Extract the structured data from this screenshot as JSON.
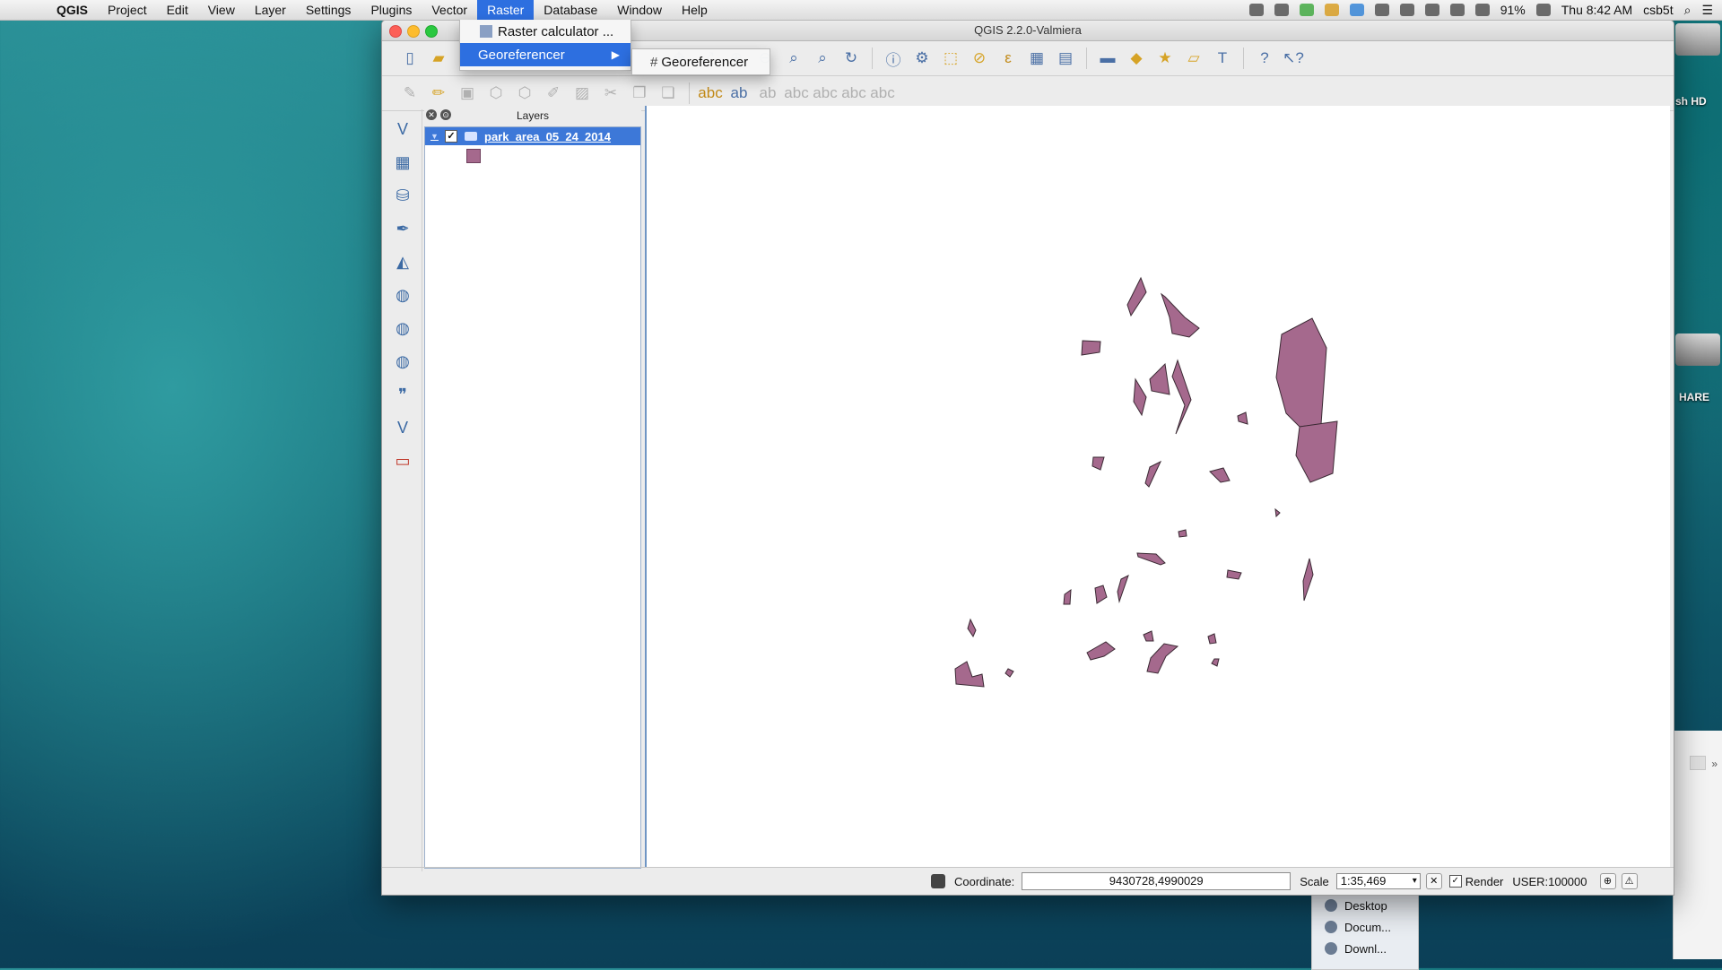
{
  "menubar": {
    "app": "QGIS",
    "items": [
      "Project",
      "Edit",
      "View",
      "Layer",
      "Settings",
      "Plugins",
      "Vector",
      "Raster",
      "Database",
      "Window",
      "Help"
    ],
    "active_item": "Raster",
    "battery": "91%",
    "clock": "Thu 8:42 AM",
    "user": "csb5t"
  },
  "window": {
    "title": "QGIS 2.2.0-Valmiera"
  },
  "raster_menu": {
    "item1": "Raster calculator ...",
    "item2": "Georeferencer",
    "submenu_item": "Georeferencer"
  },
  "layers_panel": {
    "title": "Layers",
    "layer_name": "park_area_05_24_2014",
    "layer_checked": true,
    "fill_color": "#a5698d"
  },
  "status": {
    "coordinate_label": "Coordinate:",
    "coordinate_value": "9430728,4990029",
    "scale_label": "Scale",
    "scale_value": "1:35,469",
    "render_label": "Render",
    "crs": "USER:100000"
  },
  "desktop": {
    "disk_label": "sh HD",
    "share_label": "HARE",
    "sidebar_items": [
      "Desktop",
      "Docum...",
      "Downl..."
    ]
  }
}
